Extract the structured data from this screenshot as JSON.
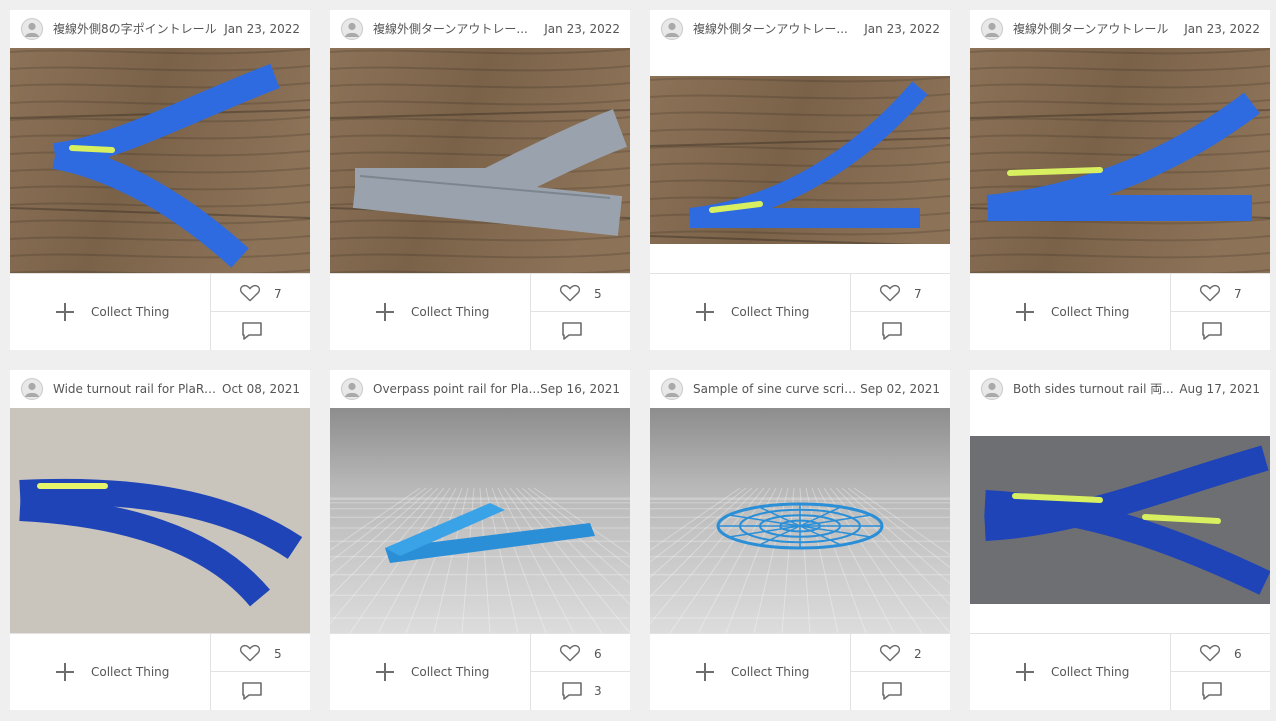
{
  "cards": [
    {
      "title": "複線外側8の字ポイントレール",
      "date": "Jan 23, 2022",
      "collect_label": "Collect Thing",
      "likes": "7",
      "comments": "",
      "photo": "blue-y-point-rail-on-wood",
      "accent": "#2f6be0"
    },
    {
      "title": "複線外側ターンアウトレー...",
      "date": "Jan 23, 2022",
      "collect_label": "Collect Thing",
      "likes": "5",
      "comments": "",
      "photo": "grey-turnout-rail-on-wood",
      "accent": "#9aa3ad"
    },
    {
      "title": "複線外側ターンアウトレー...",
      "date": "Jan 23, 2022",
      "collect_label": "Collect Thing",
      "likes": "7",
      "comments": "",
      "photo": "blue-turnout-rail-on-wood",
      "accent": "#2f6be0"
    },
    {
      "title": "複線外側ターンアウトレール",
      "date": "Jan 23, 2022",
      "collect_label": "Collect Thing",
      "likes": "7",
      "comments": "",
      "photo": "blue-turnout-rail-on-wood",
      "accent": "#2f6be0"
    },
    {
      "title": "Wide turnout rail for PlaRai...",
      "date": "Oct 08, 2021",
      "collect_label": "Collect Thing",
      "likes": "5",
      "comments": "",
      "photo": "blue-wide-turnout-rail",
      "accent": "#1f44b8"
    },
    {
      "title": "Overpass point rail for Pla...",
      "date": "Sep 16, 2021",
      "collect_label": "Collect Thing",
      "likes": "6",
      "comments": "3",
      "photo": "render-overpass-point-rail",
      "accent": "#2b8fd8"
    },
    {
      "title": "Sample of sine curve script...",
      "date": "Sep 02, 2021",
      "collect_label": "Collect Thing",
      "likes": "2",
      "comments": "",
      "photo": "render-sine-curve-disc",
      "accent": "#2b8fd8"
    },
    {
      "title": "Both sides turnout rail 両...",
      "date": "Aug 17, 2021",
      "collect_label": "Collect Thing",
      "likes": "6",
      "comments": "",
      "photo": "blue-both-sides-turnout-rail",
      "accent": "#1f44b8"
    }
  ],
  "icons": {
    "collect": "plus-icon",
    "like": "heart-icon",
    "comment": "comment-icon",
    "avatar": "user-avatar-icon"
  }
}
